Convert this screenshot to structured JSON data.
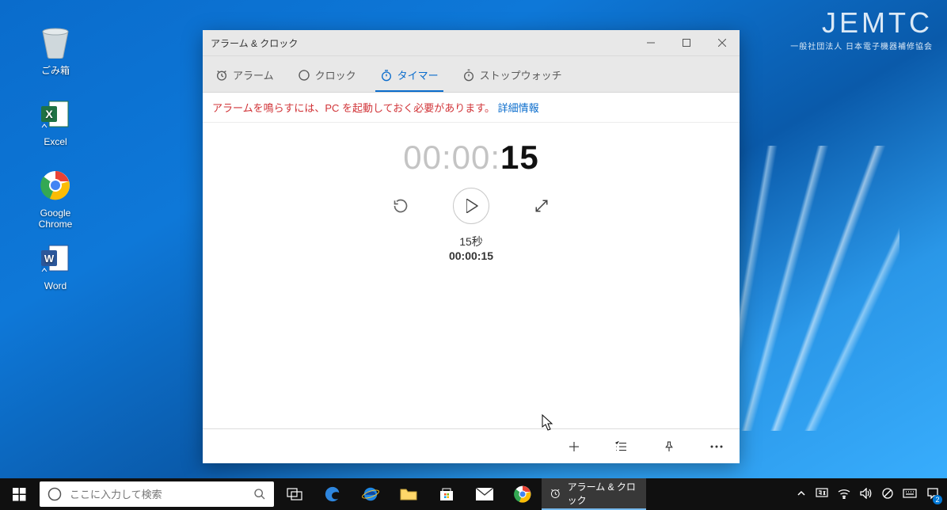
{
  "watermark": {
    "brand": "JEMTC",
    "sub": "一般社団法人 日本電子機器補修協会"
  },
  "desktop_icons": {
    "recycle": "ごみ箱",
    "excel": "Excel",
    "chrome": "Google Chrome",
    "word": "Word"
  },
  "window": {
    "title": "アラーム & クロック",
    "tabs": {
      "alarm": "アラーム",
      "clock": "クロック",
      "timer": "タイマー",
      "stopwatch": "ストップウォッチ"
    },
    "infobar": {
      "warning": "アラームを鳴らすには、PC を起動しておく必要があります。",
      "link": "詳細情報"
    },
    "timer": {
      "dim_prefix": "00:00:",
      "seconds": "15",
      "name": "15秒",
      "remaining": "00:00:15"
    }
  },
  "taskbar": {
    "search_placeholder": "ここに入力して検索",
    "active_app": "アラーム & クロック",
    "notification_count": "2"
  }
}
